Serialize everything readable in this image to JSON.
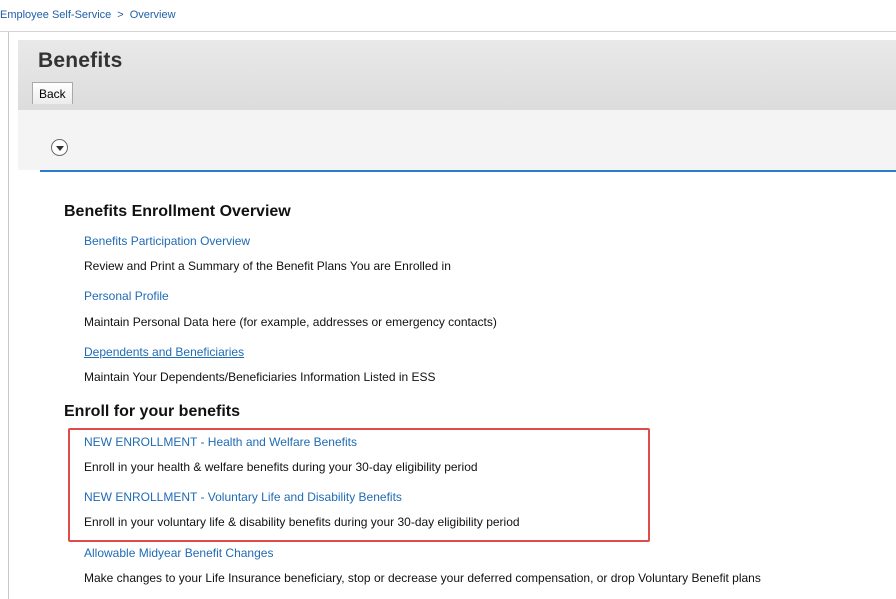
{
  "breadcrumb": {
    "root": "Employee Self-Service",
    "separator": ">",
    "current": "Overview"
  },
  "page": {
    "title": "Benefits",
    "back_label": "Back"
  },
  "sections": {
    "overview": {
      "heading": "Benefits Enrollment Overview",
      "items": [
        {
          "link": "Benefits Participation Overview",
          "description": "Review and Print a Summary of the Benefit Plans You are Enrolled in"
        },
        {
          "link": "Personal Profile",
          "description": "Maintain Personal Data here (for example, addresses or emergency contacts)"
        },
        {
          "link": "Dependents and Beneficiaries",
          "description": "Maintain Your Dependents/Beneficiaries Information Listed in ESS"
        }
      ]
    },
    "enroll": {
      "heading": "Enroll for your benefits",
      "items": [
        {
          "link": "NEW ENROLLMENT - Health and Welfare Benefits",
          "description": "Enroll in your health & welfare benefits during your 30-day eligibility period"
        },
        {
          "link": "NEW ENROLLMENT - Voluntary Life and Disability Benefits",
          "description": "Enroll in your voluntary life & disability benefits during your 30-day eligibility period"
        },
        {
          "link": "Allowable Midyear Benefit Changes",
          "description": "Make changes to your Life Insurance beneficiary, stop or decrease your deferred compensation, or drop Voluntary Benefit plans"
        }
      ]
    }
  },
  "colors": {
    "link": "#1f6bb5",
    "accent_rule": "#2e7bcf",
    "highlight": "#e04b4b"
  }
}
